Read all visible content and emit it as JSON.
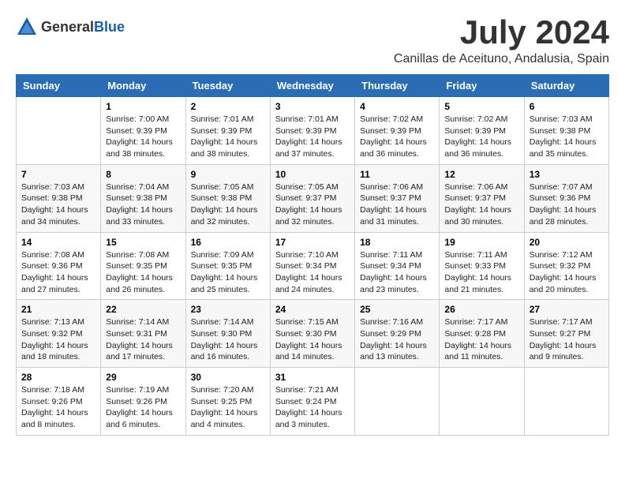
{
  "header": {
    "logo": {
      "general": "General",
      "blue": "Blue"
    },
    "title": "July 2024",
    "location": "Canillas de Aceituno, Andalusia, Spain"
  },
  "calendar": {
    "days_of_week": [
      "Sunday",
      "Monday",
      "Tuesday",
      "Wednesday",
      "Thursday",
      "Friday",
      "Saturday"
    ],
    "weeks": [
      [
        {
          "day": "",
          "info": ""
        },
        {
          "day": "1",
          "info": "Sunrise: 7:00 AM\nSunset: 9:39 PM\nDaylight: 14 hours\nand 38 minutes."
        },
        {
          "day": "2",
          "info": "Sunrise: 7:01 AM\nSunset: 9:39 PM\nDaylight: 14 hours\nand 38 minutes."
        },
        {
          "day": "3",
          "info": "Sunrise: 7:01 AM\nSunset: 9:39 PM\nDaylight: 14 hours\nand 37 minutes."
        },
        {
          "day": "4",
          "info": "Sunrise: 7:02 AM\nSunset: 9:39 PM\nDaylight: 14 hours\nand 36 minutes."
        },
        {
          "day": "5",
          "info": "Sunrise: 7:02 AM\nSunset: 9:39 PM\nDaylight: 14 hours\nand 36 minutes."
        },
        {
          "day": "6",
          "info": "Sunrise: 7:03 AM\nSunset: 9:38 PM\nDaylight: 14 hours\nand 35 minutes."
        }
      ],
      [
        {
          "day": "7",
          "info": "Sunrise: 7:03 AM\nSunset: 9:38 PM\nDaylight: 14 hours\nand 34 minutes."
        },
        {
          "day": "8",
          "info": "Sunrise: 7:04 AM\nSunset: 9:38 PM\nDaylight: 14 hours\nand 33 minutes."
        },
        {
          "day": "9",
          "info": "Sunrise: 7:05 AM\nSunset: 9:38 PM\nDaylight: 14 hours\nand 32 minutes."
        },
        {
          "day": "10",
          "info": "Sunrise: 7:05 AM\nSunset: 9:37 PM\nDaylight: 14 hours\nand 32 minutes."
        },
        {
          "day": "11",
          "info": "Sunrise: 7:06 AM\nSunset: 9:37 PM\nDaylight: 14 hours\nand 31 minutes."
        },
        {
          "day": "12",
          "info": "Sunrise: 7:06 AM\nSunset: 9:37 PM\nDaylight: 14 hours\nand 30 minutes."
        },
        {
          "day": "13",
          "info": "Sunrise: 7:07 AM\nSunset: 9:36 PM\nDaylight: 14 hours\nand 28 minutes."
        }
      ],
      [
        {
          "day": "14",
          "info": "Sunrise: 7:08 AM\nSunset: 9:36 PM\nDaylight: 14 hours\nand 27 minutes."
        },
        {
          "day": "15",
          "info": "Sunrise: 7:08 AM\nSunset: 9:35 PM\nDaylight: 14 hours\nand 26 minutes."
        },
        {
          "day": "16",
          "info": "Sunrise: 7:09 AM\nSunset: 9:35 PM\nDaylight: 14 hours\nand 25 minutes."
        },
        {
          "day": "17",
          "info": "Sunrise: 7:10 AM\nSunset: 9:34 PM\nDaylight: 14 hours\nand 24 minutes."
        },
        {
          "day": "18",
          "info": "Sunrise: 7:11 AM\nSunset: 9:34 PM\nDaylight: 14 hours\nand 23 minutes."
        },
        {
          "day": "19",
          "info": "Sunrise: 7:11 AM\nSunset: 9:33 PM\nDaylight: 14 hours\nand 21 minutes."
        },
        {
          "day": "20",
          "info": "Sunrise: 7:12 AM\nSunset: 9:32 PM\nDaylight: 14 hours\nand 20 minutes."
        }
      ],
      [
        {
          "day": "21",
          "info": "Sunrise: 7:13 AM\nSunset: 9:32 PM\nDaylight: 14 hours\nand 18 minutes."
        },
        {
          "day": "22",
          "info": "Sunrise: 7:14 AM\nSunset: 9:31 PM\nDaylight: 14 hours\nand 17 minutes."
        },
        {
          "day": "23",
          "info": "Sunrise: 7:14 AM\nSunset: 9:30 PM\nDaylight: 14 hours\nand 16 minutes."
        },
        {
          "day": "24",
          "info": "Sunrise: 7:15 AM\nSunset: 9:30 PM\nDaylight: 14 hours\nand 14 minutes."
        },
        {
          "day": "25",
          "info": "Sunrise: 7:16 AM\nSunset: 9:29 PM\nDaylight: 14 hours\nand 13 minutes."
        },
        {
          "day": "26",
          "info": "Sunrise: 7:17 AM\nSunset: 9:28 PM\nDaylight: 14 hours\nand 11 minutes."
        },
        {
          "day": "27",
          "info": "Sunrise: 7:17 AM\nSunset: 9:27 PM\nDaylight: 14 hours\nand 9 minutes."
        }
      ],
      [
        {
          "day": "28",
          "info": "Sunrise: 7:18 AM\nSunset: 9:26 PM\nDaylight: 14 hours\nand 8 minutes."
        },
        {
          "day": "29",
          "info": "Sunrise: 7:19 AM\nSunset: 9:26 PM\nDaylight: 14 hours\nand 6 minutes."
        },
        {
          "day": "30",
          "info": "Sunrise: 7:20 AM\nSunset: 9:25 PM\nDaylight: 14 hours\nand 4 minutes."
        },
        {
          "day": "31",
          "info": "Sunrise: 7:21 AM\nSunset: 9:24 PM\nDaylight: 14 hours\nand 3 minutes."
        },
        {
          "day": "",
          "info": ""
        },
        {
          "day": "",
          "info": ""
        },
        {
          "day": "",
          "info": ""
        }
      ]
    ]
  }
}
